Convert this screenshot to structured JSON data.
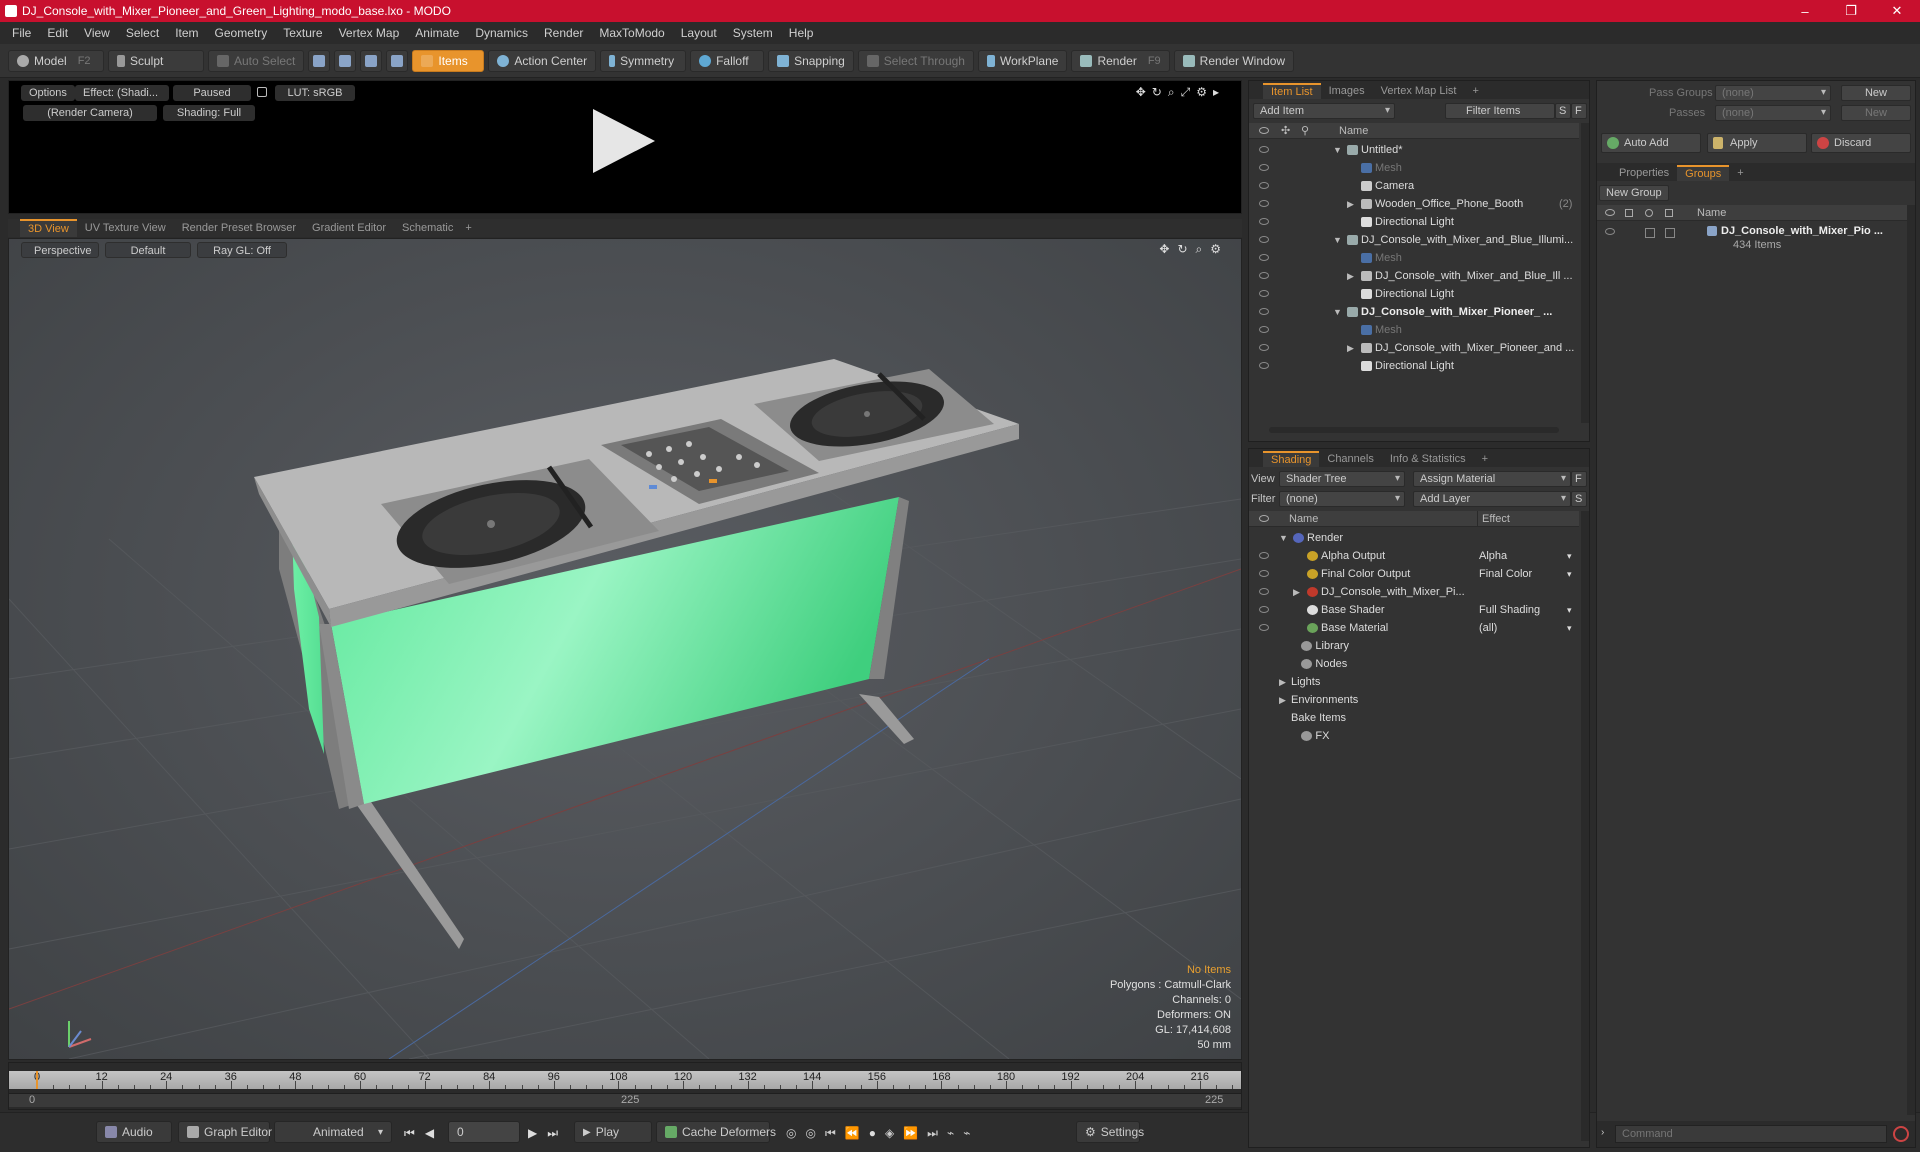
{
  "window": {
    "title": "DJ_Console_with_Mixer_Pioneer_and_Green_Lighting_modo_base.lxo - MODO",
    "min": "–",
    "max": "❐",
    "close": "✕"
  },
  "menu": [
    "File",
    "Edit",
    "View",
    "Select",
    "Item",
    "Geometry",
    "Texture",
    "Vertex Map",
    "Animate",
    "Dynamics",
    "Render",
    "MaxToModo",
    "Layout",
    "System",
    "Help"
  ],
  "toolbar": {
    "model": "Model",
    "model_key": "F2",
    "sculpt": "Sculpt",
    "auto_select": "Auto Select",
    "items": "Items",
    "action_center": "Action Center",
    "symmetry": "Symmetry",
    "falloff": "Falloff",
    "snapping": "Snapping",
    "select_through": "Select Through",
    "workplane": "WorkPlane",
    "render": "Render",
    "render_key": "F9",
    "render_window": "Render Window"
  },
  "render_preview": {
    "options": "Options",
    "effect": "Effect: (Shadi...",
    "paused": "Paused",
    "lut": "LUT: sRGB",
    "camera": "(Render Camera)",
    "shading": "Shading: Full"
  },
  "viewport_tabs": [
    "3D View",
    "UV Texture View",
    "Render Preset Browser",
    "Gradient Editor",
    "Schematic"
  ],
  "viewport": {
    "perspective": "Perspective",
    "default": "Default",
    "raygl": "Ray GL: Off",
    "info": [
      "No Items",
      "Polygons : Catmull-Clark",
      "Channels: 0",
      "Deformers: ON",
      "GL: 17,414,608",
      "50 mm"
    ]
  },
  "timeline": {
    "ticks": [
      "0",
      "12",
      "24",
      "36",
      "48",
      "60",
      "72",
      "84",
      "96",
      "108",
      "120",
      "132",
      "144",
      "156",
      "168",
      "180",
      "192",
      "204",
      "216"
    ],
    "range_start": "0",
    "range_mid": "225",
    "range_end": "225"
  },
  "bottombar": {
    "audio": "Audio",
    "graph_editor": "Graph Editor",
    "animated": "Animated",
    "frame": "0",
    "play": "Play",
    "cache_deformers": "Cache Deformers",
    "settings": "Settings"
  },
  "item_list": {
    "tabs": [
      "Item List",
      "Images",
      "Vertex Map List"
    ],
    "add_item": "Add Item",
    "filter_items": "Filter Items",
    "s": "S",
    "f": "F",
    "col_name": "Name",
    "rows": [
      {
        "label": "Untitled*",
        "indent": 0,
        "tri": "▼",
        "style": "",
        "icon": "#9aa"
      },
      {
        "label": "Mesh",
        "indent": 1,
        "tri": "",
        "style": "dim",
        "icon": "#4a6fa5"
      },
      {
        "label": "Camera",
        "indent": 1,
        "tri": "",
        "style": "",
        "icon": "#ccc"
      },
      {
        "label": "Wooden_Office_Phone_Booth",
        "count": "(2)",
        "indent": 1,
        "tri": "▶",
        "style": "",
        "icon": "#bbb"
      },
      {
        "label": "Directional Light",
        "indent": 1,
        "tri": "",
        "style": "",
        "icon": "#ddd"
      },
      {
        "label": "DJ_Console_with_Mixer_and_Blue_Illumi...",
        "indent": 0,
        "tri": "▼",
        "style": "",
        "icon": "#9aa"
      },
      {
        "label": "Mesh",
        "indent": 1,
        "tri": "",
        "style": "dim",
        "icon": "#4a6fa5"
      },
      {
        "label": "DJ_Console_with_Mixer_and_Blue_Ill ...",
        "indent": 1,
        "tri": "▶",
        "style": "",
        "icon": "#bbb"
      },
      {
        "label": "Directional Light",
        "indent": 1,
        "tri": "",
        "style": "",
        "icon": "#ddd"
      },
      {
        "label": "DJ_Console_with_Mixer_Pioneer_ ...",
        "indent": 0,
        "tri": "▼",
        "style": "bold",
        "icon": "#9aa"
      },
      {
        "label": "Mesh",
        "indent": 1,
        "tri": "",
        "style": "dim",
        "icon": "#4a6fa5"
      },
      {
        "label": "DJ_Console_with_Mixer_Pioneer_and ...",
        "indent": 1,
        "tri": "▶",
        "style": "",
        "icon": "#bbb"
      },
      {
        "label": "Directional Light",
        "indent": 1,
        "tri": "",
        "style": "",
        "icon": "#ddd"
      }
    ]
  },
  "shading": {
    "tabs": [
      "Shading",
      "Channels",
      "Info & Statistics"
    ],
    "view_label": "View",
    "view_value": "Shader Tree",
    "assign_material": "Assign Material",
    "f": "F",
    "filter_label": "Filter",
    "filter_value": "(none)",
    "add_layer": "Add Layer",
    "s": "S",
    "col_name": "Name",
    "col_effect": "Effect",
    "rows": [
      {
        "label": "Render",
        "effect": "",
        "indent": 0,
        "tri": "▼",
        "eye": false,
        "icon": "#5566bb"
      },
      {
        "label": "Alpha Output",
        "effect": "Alpha",
        "indent": 1,
        "tri": "",
        "eye": true,
        "icon": "#c9a227"
      },
      {
        "label": "Final Color Output",
        "effect": "Final Color",
        "indent": 1,
        "tri": "",
        "eye": true,
        "icon": "#c9a227"
      },
      {
        "label": "DJ_Console_with_Mixer_Pi...",
        "effect": "",
        "indent": 1,
        "tri": "▶",
        "eye": true,
        "icon": "#c0392b"
      },
      {
        "label": "Base Shader",
        "effect": "Full Shading",
        "indent": 1,
        "tri": "",
        "eye": true,
        "icon": "#dddddd"
      },
      {
        "label": "Base Material",
        "effect": "(all)",
        "indent": 1,
        "tri": "",
        "eye": true,
        "icon": "#6aa35a"
      },
      {
        "label": "Library",
        "effect": "",
        "indent": 0.6,
        "tri": "",
        "eye": false,
        "icon": "#999"
      },
      {
        "label": "Nodes",
        "effect": "",
        "indent": 0.6,
        "tri": "",
        "eye": false,
        "icon": "#999"
      },
      {
        "label": "Lights",
        "effect": "",
        "indent": 0,
        "tri": "▶",
        "eye": false,
        "icon": ""
      },
      {
        "label": "Environments",
        "effect": "",
        "indent": 0,
        "tri": "▶",
        "eye": false,
        "icon": ""
      },
      {
        "label": "Bake Items",
        "effect": "",
        "indent": 0,
        "tri": "",
        "eye": false,
        "icon": ""
      },
      {
        "label": "FX",
        "effect": "",
        "indent": 0.6,
        "tri": "",
        "eye": false,
        "icon": "#999"
      }
    ]
  },
  "groups": {
    "pass_groups": "Pass Groups",
    "pass_groups_value": "(none)",
    "new1": "New",
    "passes": "Passes",
    "passes_value": "(none)",
    "new2": "New",
    "auto_add": "Auto Add",
    "apply": "Apply",
    "discard": "Discard",
    "tabs": [
      "Properties",
      "Groups"
    ],
    "new_group": "New Group",
    "col_name": "Name",
    "item_name": "DJ_Console_with_Mixer_Pio ...",
    "item_count": "434 Items"
  },
  "command": {
    "placeholder": "Command"
  }
}
